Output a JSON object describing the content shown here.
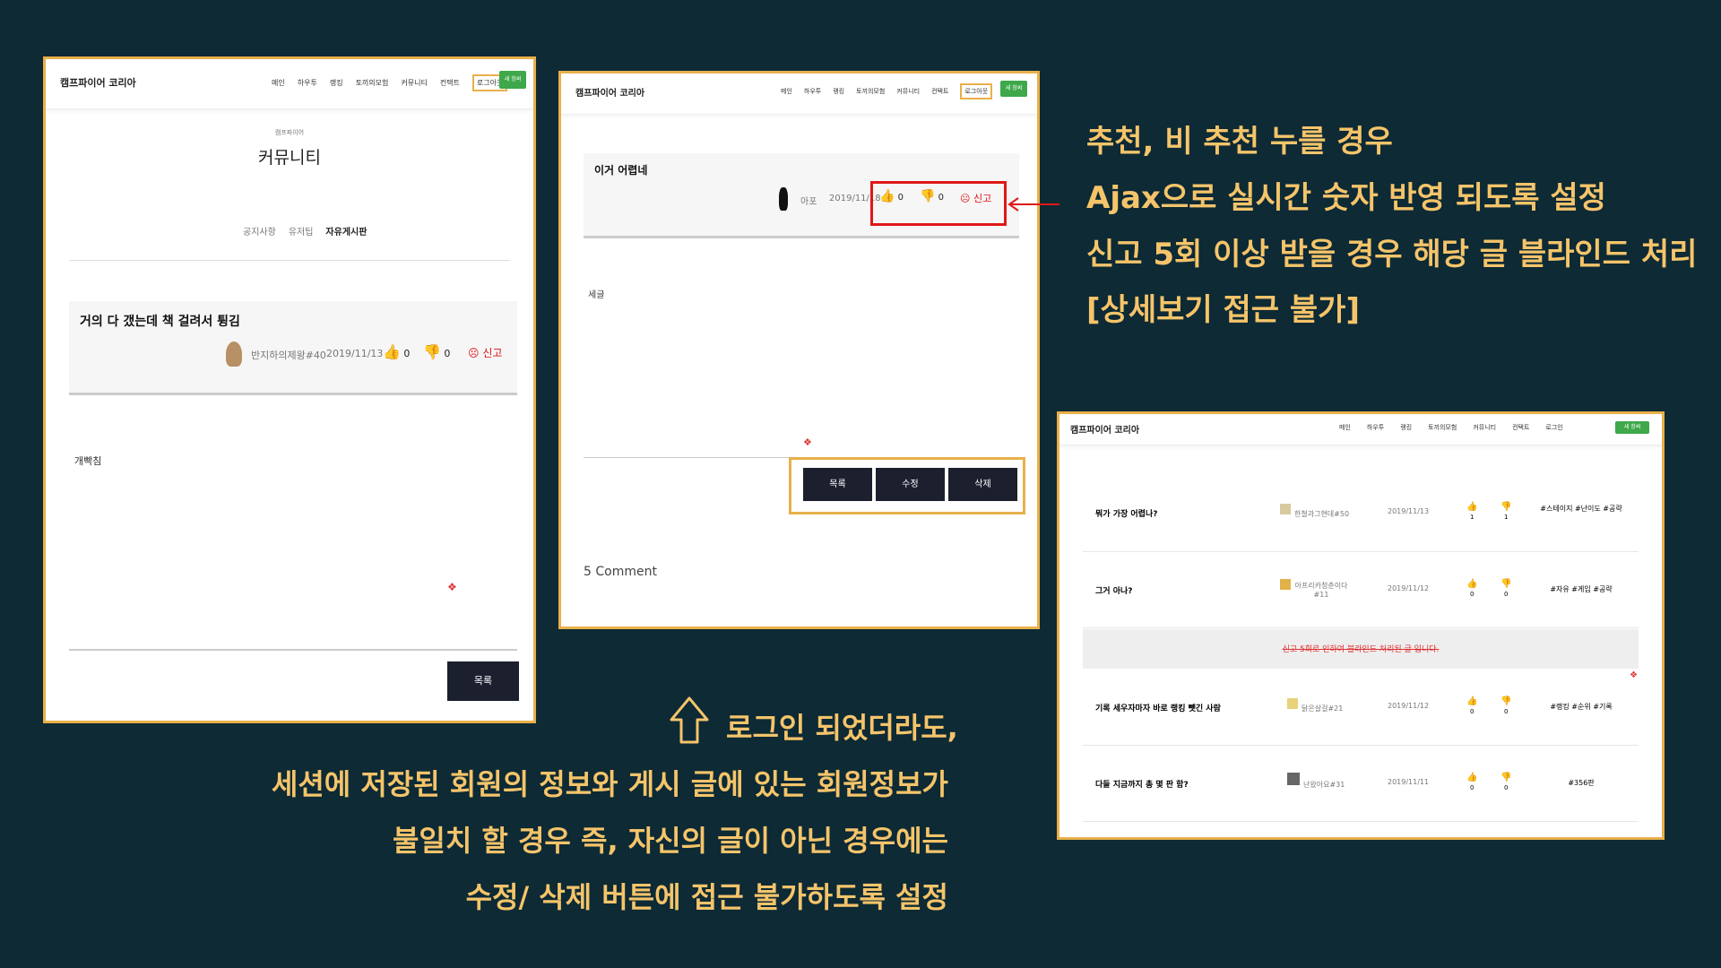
{
  "colors": {
    "background": "#0d2a35",
    "annotation": "#f5c46a",
    "frame": "#e8b04a",
    "highlight_red": "#e01818",
    "green_button": "#3ea84a",
    "dark_button": "#1b1f2e"
  },
  "nav": {
    "brand": "캠프파이어 코리아",
    "items_logout": [
      "메인",
      "하우투",
      "랭킹",
      "토끼의모험",
      "커뮤니티",
      "컨택트",
      "로그아웃"
    ],
    "items_login": [
      "메인",
      "하우투",
      "랭킹",
      "토끼의모험",
      "커뮤니티",
      "컨택트",
      "로그인"
    ],
    "green_button": "새 창써"
  },
  "shot1": {
    "subheader": "캠프파이어",
    "page_title": "커뮤니티",
    "tabs": [
      "공지사항",
      "유저팁",
      "자유게시판"
    ],
    "post_title": "거의 다 갰는데 책 걸려서 튕김",
    "author": "반지하의제왕#40",
    "date": "2019/11/13",
    "likes": "0",
    "dislikes": "0",
    "report": "신고",
    "body": "개빡침",
    "list_button": "목록"
  },
  "shot2": {
    "post_title": "이거 어렵네",
    "author": "아포",
    "date": "2019/11/18",
    "likes": "0",
    "dislikes": "0",
    "report": "신고",
    "body": "세글",
    "buttons": [
      "목록",
      "수정",
      "삭제"
    ],
    "comments": "5 Comment"
  },
  "shot3": {
    "rows": [
      {
        "title": "뭐가 가장 어렵나?",
        "author": "한철과그현데#50",
        "date": "2019/11/13",
        "likes": "1",
        "dislikes": "1",
        "tags": "#스테이지 #난이도 #공략"
      },
      {
        "title": "그거 아나?",
        "author": "아프리카청춘이다 #11",
        "date": "2019/11/12",
        "likes": "0",
        "dislikes": "0",
        "tags": "#자유 #게임 #공략"
      },
      {
        "title": "기록 세우자마자 바로 랭킹 뺏긴 사람",
        "author": "닭은살걸#21",
        "date": "2019/11/12",
        "likes": "0",
        "dislikes": "0",
        "tags": "#랭킹 #순위 #기록"
      },
      {
        "title": "다들 지금까지 총 몇 판 함?",
        "author": "난왔아요#31",
        "date": "2019/11/11",
        "likes": "0",
        "dislikes": "0",
        "tags": "#356판"
      }
    ],
    "blinded": "신고 5회로 인하여 블라인드 처리된 글 입니다."
  },
  "annotations": {
    "right": [
      "추천, 비 추천 누를 경우",
      "Ajax으로 실시간 숫자 반영 되도록 설정",
      "신고 5회 이상 받을 경우 해당 글 블라인드 처리",
      "[상세보기 접근 불가]"
    ],
    "bottom": [
      "로그인 되었더라도,",
      "세션에 저장된 회원의 정보와 게시 글에 있는 회원정보가",
      "불일치 할 경우 즉, 자신의 글이 아닌 경우에는",
      "수정/ 삭제 버튼에 접근 불가하도록 설정"
    ]
  }
}
